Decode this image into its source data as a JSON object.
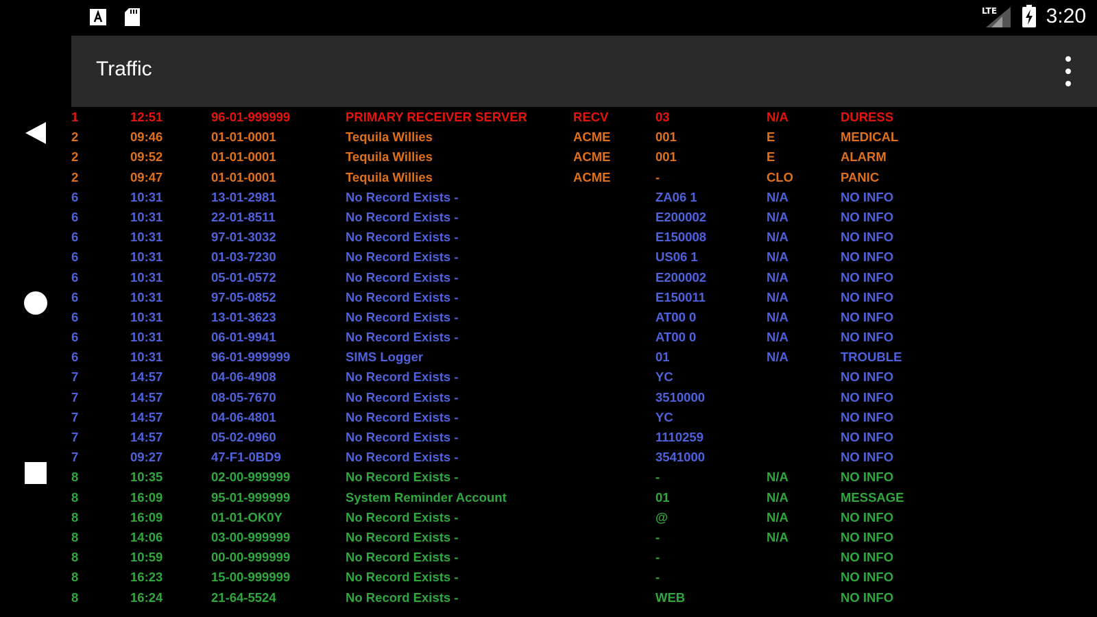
{
  "status_bar": {
    "time": "3:20",
    "network_label": "LTE",
    "left_icons": [
      "app-a-icon",
      "sd-card-icon"
    ]
  },
  "app_bar": {
    "title": "Traffic",
    "menu_icon": "more-vert-icon"
  },
  "colors": {
    "p1": "#e8140c",
    "p2": "#e0701a",
    "p6": "#4f62dc",
    "p7": "#4f62dc",
    "p8": "#2fa83e"
  },
  "rows": [
    {
      "priority": "1",
      "time": "12:51",
      "account": "96-01-999999",
      "name": "PRIMARY RECEIVER SERVER",
      "group": "RECV",
      "zone": "03",
      "status": "N/A",
      "type": "DURESS",
      "color": "#e8140c"
    },
    {
      "priority": "2",
      "time": "09:46",
      "account": "01-01-0001",
      "name": "Tequila Willies",
      "group": "ACME",
      "zone": "001",
      "status": "E",
      "type": "MEDICAL",
      "color": "#e0701a"
    },
    {
      "priority": "2",
      "time": "09:52",
      "account": "01-01-0001",
      "name": "Tequila Willies",
      "group": "ACME",
      "zone": "001",
      "status": "E",
      "type": "ALARM",
      "color": "#e0701a"
    },
    {
      "priority": "2",
      "time": "09:47",
      "account": "01-01-0001",
      "name": "Tequila Willies",
      "group": "ACME",
      "zone": "-",
      "status": "CLO",
      "type": "PANIC",
      "color": "#e0701a"
    },
    {
      "priority": "6",
      "time": "10:31",
      "account": "13-01-2981",
      "name": "No Record Exists -",
      "group": "",
      "zone": "ZA06 1",
      "status": "N/A",
      "type": "NO INFO",
      "color": "#4f62dc"
    },
    {
      "priority": "6",
      "time": "10:31",
      "account": "22-01-8511",
      "name": "No Record Exists -",
      "group": "",
      "zone": "E200002",
      "status": "N/A",
      "type": "NO INFO",
      "color": "#4f62dc"
    },
    {
      "priority": "6",
      "time": "10:31",
      "account": "97-01-3032",
      "name": "No Record Exists -",
      "group": "",
      "zone": "E150008",
      "status": "N/A",
      "type": "NO INFO",
      "color": "#4f62dc"
    },
    {
      "priority": "6",
      "time": "10:31",
      "account": "01-03-7230",
      "name": "No Record Exists -",
      "group": "",
      "zone": "US06 1",
      "status": "N/A",
      "type": "NO INFO",
      "color": "#4f62dc"
    },
    {
      "priority": "6",
      "time": "10:31",
      "account": "05-01-0572",
      "name": "No Record Exists -",
      "group": "",
      "zone": "E200002",
      "status": "N/A",
      "type": "NO INFO",
      "color": "#4f62dc"
    },
    {
      "priority": "6",
      "time": "10:31",
      "account": "97-05-0852",
      "name": "No Record Exists -",
      "group": "",
      "zone": "E150011",
      "status": "N/A",
      "type": "NO INFO",
      "color": "#4f62dc"
    },
    {
      "priority": "6",
      "time": "10:31",
      "account": "13-01-3623",
      "name": "No Record Exists -",
      "group": "",
      "zone": "AT00 0",
      "status": "N/A",
      "type": "NO INFO",
      "color": "#4f62dc"
    },
    {
      "priority": "6",
      "time": "10:31",
      "account": "06-01-9941",
      "name": "No Record Exists -",
      "group": "",
      "zone": "AT00 0",
      "status": "N/A",
      "type": "NO INFO",
      "color": "#4f62dc"
    },
    {
      "priority": "6",
      "time": "10:31",
      "account": "96-01-999999",
      "name": "SIMS Logger",
      "group": "",
      "zone": "01",
      "status": "N/A",
      "type": "TROUBLE",
      "color": "#4f62dc"
    },
    {
      "priority": "7",
      "time": "14:57",
      "account": "04-06-4908",
      "name": "No Record Exists -",
      "group": "",
      "zone": "YC",
      "status": "",
      "type": "NO INFO",
      "color": "#4f62dc"
    },
    {
      "priority": "7",
      "time": "14:57",
      "account": "08-05-7670",
      "name": "No Record Exists -",
      "group": "",
      "zone": "3510000",
      "status": "",
      "type": "NO INFO",
      "color": "#4f62dc"
    },
    {
      "priority": "7",
      "time": "14:57",
      "account": "04-06-4801",
      "name": "No Record Exists -",
      "group": "",
      "zone": "YC",
      "status": "",
      "type": "NO INFO",
      "color": "#4f62dc"
    },
    {
      "priority": "7",
      "time": "14:57",
      "account": "05-02-0960",
      "name": "No Record Exists -",
      "group": "",
      "zone": "1110259",
      "status": "",
      "type": "NO INFO",
      "color": "#4f62dc"
    },
    {
      "priority": "7",
      "time": "09:27",
      "account": "47-F1-0BD9",
      "name": "No Record Exists -",
      "group": "",
      "zone": "3541000",
      "status": "",
      "type": "NO INFO",
      "color": "#4f62dc"
    },
    {
      "priority": "8",
      "time": "10:35",
      "account": "02-00-999999",
      "name": "No Record Exists -",
      "group": "",
      "zone": "-",
      "status": "N/A",
      "type": "NO INFO",
      "color": "#2fa83e"
    },
    {
      "priority": "8",
      "time": "16:09",
      "account": "95-01-999999",
      "name": "System Reminder Account",
      "group": "",
      "zone": "01",
      "status": "N/A",
      "type": "MESSAGE",
      "color": "#2fa83e"
    },
    {
      "priority": "8",
      "time": "16:09",
      "account": "01-01-OK0Y",
      "name": "No Record Exists -",
      "group": "",
      "zone": "@",
      "status": "N/A",
      "type": "NO INFO",
      "color": "#2fa83e"
    },
    {
      "priority": "8",
      "time": "14:06",
      "account": "03-00-999999",
      "name": "No Record Exists -",
      "group": "",
      "zone": "-",
      "status": "N/A",
      "type": "NO INFO",
      "color": "#2fa83e"
    },
    {
      "priority": "8",
      "time": "10:59",
      "account": "00-00-999999",
      "name": "No Record Exists -",
      "group": "",
      "zone": "-",
      "status": "",
      "type": "NO INFO",
      "color": "#2fa83e"
    },
    {
      "priority": "8",
      "time": "16:23",
      "account": "15-00-999999",
      "name": "No Record Exists -",
      "group": "",
      "zone": "-",
      "status": "",
      "type": "NO INFO",
      "color": "#2fa83e"
    },
    {
      "priority": "8",
      "time": "16:24",
      "account": "21-64-5524",
      "name": "No Record Exists -",
      "group": "",
      "zone": "WEB",
      "status": "",
      "type": "NO INFO",
      "color": "#2fa83e"
    }
  ]
}
